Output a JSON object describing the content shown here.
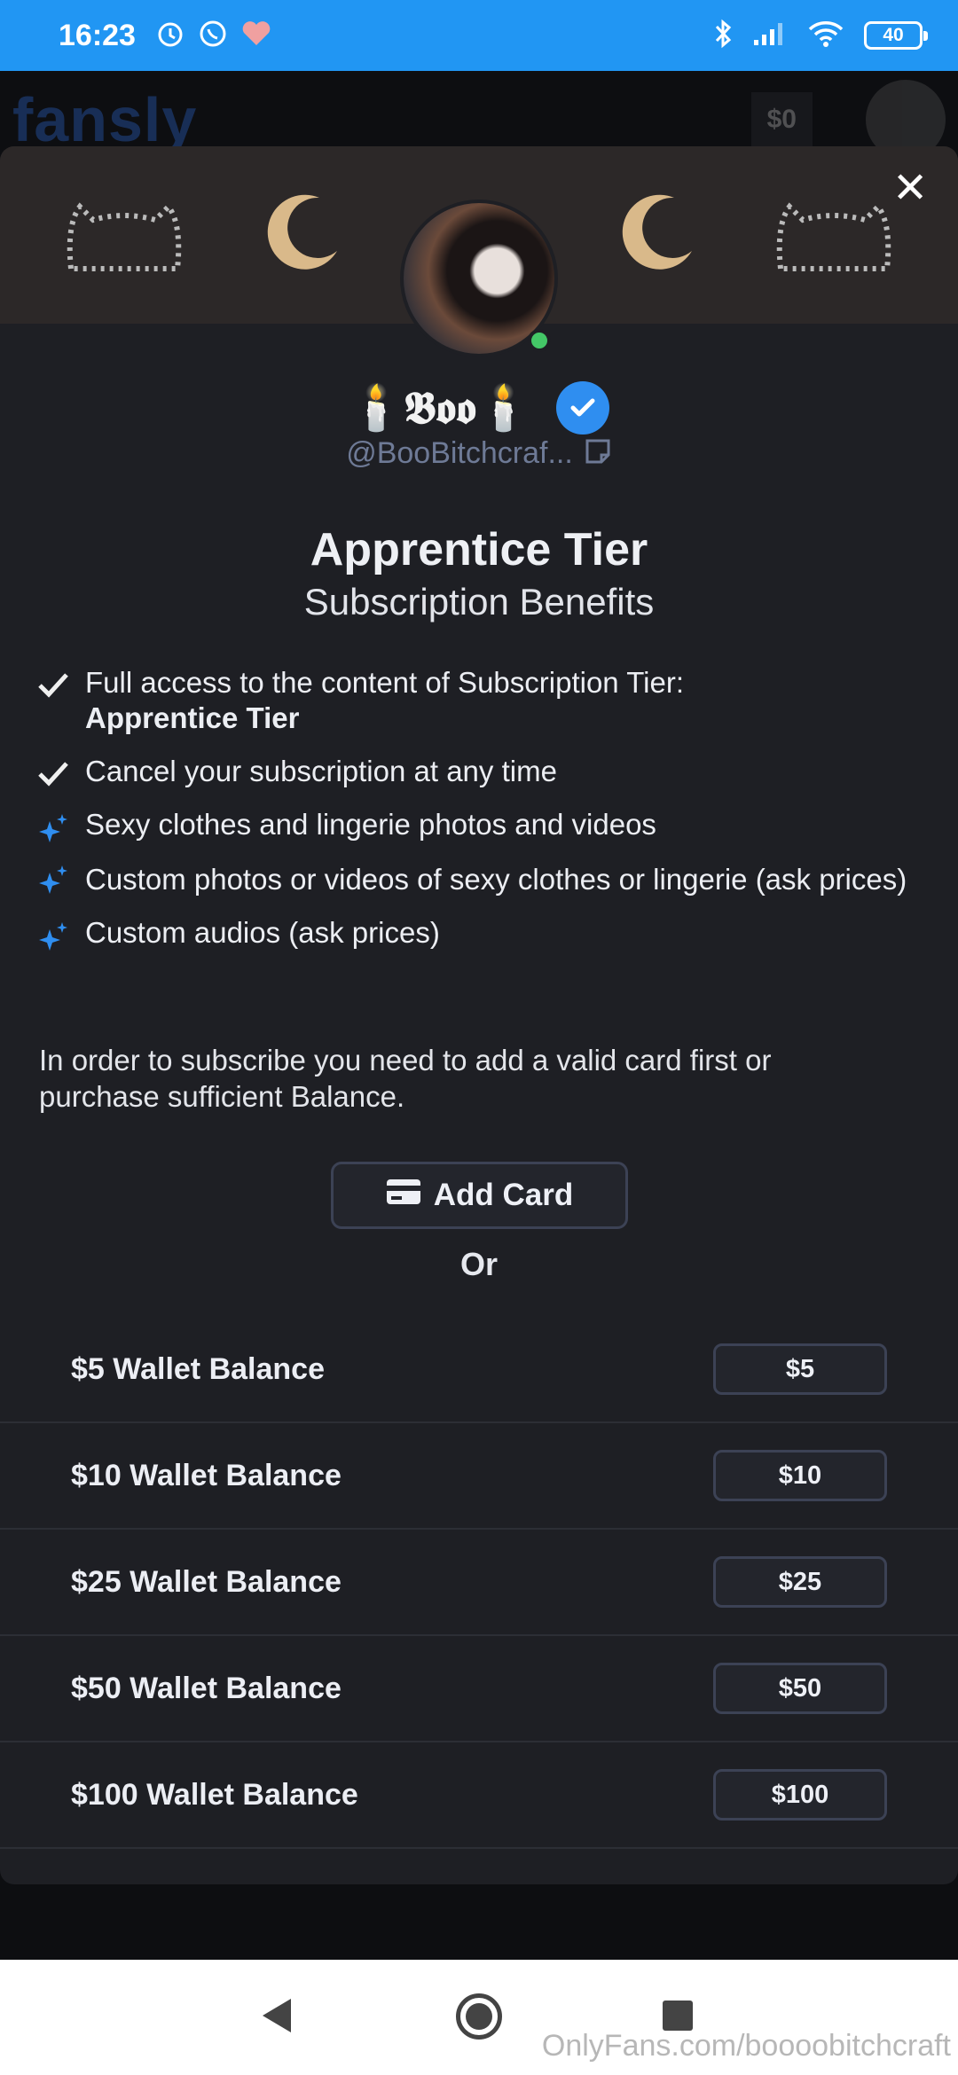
{
  "status_bar": {
    "time": "16:23",
    "battery": "40"
  },
  "background_page": {
    "logo": "fansly",
    "wallet": "$0"
  },
  "creator": {
    "display_name": "🕯️𝕭𝖔𝖔🕯️",
    "handle": "@BooBitchcraf..."
  },
  "tier": {
    "title": "Apprentice Tier",
    "subtitle": "Subscription Benefits"
  },
  "benefits": [
    {
      "icon": "check-icon",
      "text": "Full access to the content of Subscription Tier:",
      "bold": "Apprentice Tier"
    },
    {
      "icon": "check-icon",
      "text": "Cancel your subscription at any time"
    },
    {
      "icon": "sparkle-icon",
      "text": "Sexy clothes and lingerie photos and videos"
    },
    {
      "icon": "sparkle-icon",
      "text": "Custom photos or videos of sexy clothes or lingerie (ask prices)"
    },
    {
      "icon": "sparkle-icon",
      "text": "Custom audios (ask prices)"
    }
  ],
  "notice": "In order to subscribe you need to add a valid card first or purchase sufficient Balance.",
  "add_card_label": "Add Card",
  "or_label": "Or",
  "wallet_options": [
    {
      "label": "$5 Wallet Balance",
      "button": "$5"
    },
    {
      "label": "$10 Wallet Balance",
      "button": "$10"
    },
    {
      "label": "$25 Wallet Balance",
      "button": "$25"
    },
    {
      "label": "$50 Wallet Balance",
      "button": "$50"
    },
    {
      "label": "$100 Wallet Balance",
      "button": "$100"
    }
  ],
  "watermark": "OnlyFans.com/boooobitchcraft",
  "colors": {
    "status_bar": "#2196f3",
    "verified": "#2f8ef0",
    "online": "#44c767",
    "modal_bg": "#1e1f24"
  }
}
